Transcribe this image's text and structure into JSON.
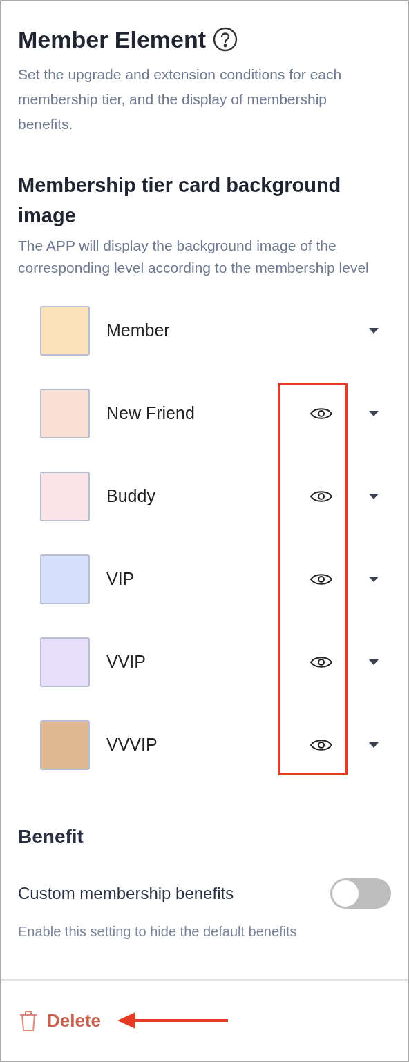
{
  "title": "Member Element",
  "description": "Set the upgrade and extension conditions for each membership tier, and the display of membership benefits.",
  "background_section": {
    "heading": "Membership tier card background image",
    "description": "The APP will display the background image of the corresponding level according to the membership level",
    "tiers": [
      {
        "name": "Member",
        "color": "#fae1b9",
        "preview": false
      },
      {
        "name": "New Friend",
        "color": "#fae0d3",
        "preview": true
      },
      {
        "name": "Buddy",
        "color": "#fae5e8",
        "preview": true
      },
      {
        "name": "VIP",
        "color": "#d6e0fa",
        "preview": true
      },
      {
        "name": "VVIP",
        "color": "#e6defb",
        "preview": true
      },
      {
        "name": "VVVIP",
        "color": "#dfb992",
        "preview": true
      }
    ]
  },
  "benefit_section": {
    "heading": "Benefit",
    "setting": {
      "label": "Custom membership benefits",
      "on": false
    },
    "hint": "Enable this setting to hide the default benefits"
  },
  "footer": {
    "delete_label": "Delete"
  }
}
